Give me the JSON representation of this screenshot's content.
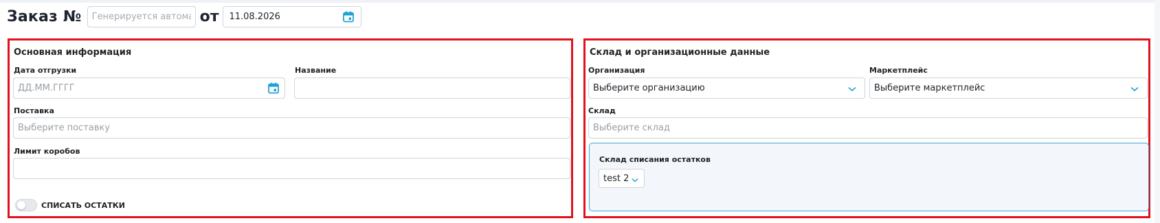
{
  "header": {
    "order_title": "Заказ №",
    "order_number_placeholder": "Генерируется автоматич",
    "from_label": "от",
    "order_date": "11.08.2026"
  },
  "main_info": {
    "title": "Основная информация",
    "ship_date_label": "Дата отгрузки",
    "ship_date_placeholder": "ДД.ММ.ГГГГ",
    "name_label": "Название",
    "name_value": "",
    "supply_label": "Поставка",
    "supply_placeholder": "Выберите поставку",
    "box_limit_label": "Лимит коробов",
    "box_limit_value": "",
    "write_off_toggle_label": "СПИСАТЬ ОСТАТКИ",
    "write_off_enabled": false
  },
  "warehouse": {
    "title": "Склад и организационные данные",
    "org_label": "Организация",
    "org_placeholder": "Выберите организацию",
    "marketplace_label": "Маркетплейс",
    "marketplace_placeholder": "Выберите маркетплейс",
    "warehouse_label": "Склад",
    "warehouse_placeholder": "Выберите склад",
    "writeoff_warehouse_label": "Склад списания остатков",
    "writeoff_warehouse_value": "test 2"
  },
  "colors": {
    "accent": "#1fa2d6",
    "highlight_border": "#e2101b",
    "subpanel_border": "#3aa6d6"
  },
  "icons": [
    "calendar-icon",
    "chevron-down-icon"
  ]
}
